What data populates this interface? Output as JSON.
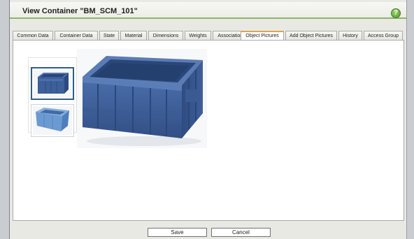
{
  "window": {
    "title": "View Container \"BM_SCM_101\"",
    "help_icon": "?"
  },
  "tabs": [
    {
      "label": "Common Data"
    },
    {
      "label": "Container Data"
    },
    {
      "label": "State"
    },
    {
      "label": "Material"
    },
    {
      "label": "Dimensions"
    },
    {
      "label": "Weights"
    },
    {
      "label": "Associations"
    },
    {
      "label": "Object Pictures",
      "active": true
    },
    {
      "label": "Add Object Pictures"
    },
    {
      "label": "History"
    },
    {
      "label": "Access Group"
    }
  ],
  "pictures": {
    "thumbnails": [
      {
        "icon": "container-crate-icon",
        "selected": true
      },
      {
        "icon": "container-crate-icon",
        "selected": false
      }
    ],
    "main_image_icon": "container-crate-icon"
  },
  "buttons": {
    "save_label": "Save",
    "cancel_label": "Cancel"
  },
  "colors": {
    "accent_green": "#8fb36a",
    "active_tab_orange": "#e8a23c",
    "crate_blue": "#3d5f9a"
  }
}
